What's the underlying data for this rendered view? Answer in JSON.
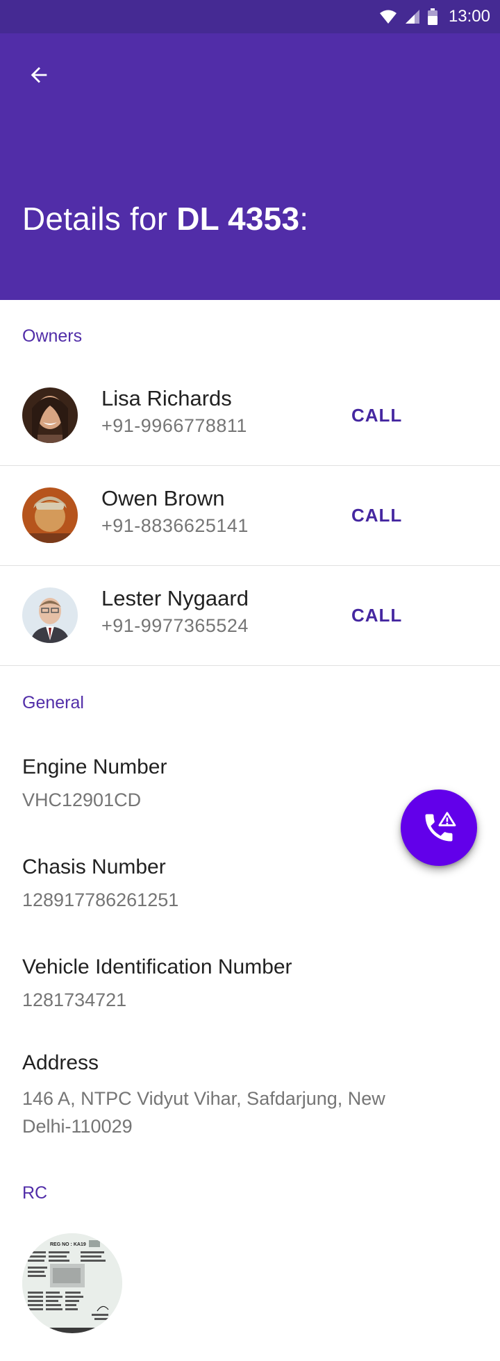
{
  "status_bar": {
    "time": "13:00"
  },
  "app_bar": {
    "title_prefix": "Details for ",
    "vehicle_id": "DL 4353",
    "title_suffix": ":"
  },
  "owners": {
    "header": "Owners",
    "items": [
      {
        "name": "Lisa Richards",
        "phone": "+91-9966778811",
        "action": "CALL"
      },
      {
        "name": "Owen Brown",
        "phone": "+91-8836625141",
        "action": "CALL"
      },
      {
        "name": "Lester Nygaard",
        "phone": "+91-9977365524",
        "action": "CALL"
      }
    ]
  },
  "general": {
    "header": "General",
    "fields": [
      {
        "label": "Engine Number",
        "value": "VHC12901CD"
      },
      {
        "label": "Chasis Number",
        "value": "128917786261251"
      },
      {
        "label": "Vehicle Identification Number",
        "value": "1281734721"
      },
      {
        "label": "Address",
        "value": "146 A, NTPC Vidyut Vihar, Safdarjung, New Delhi-110029"
      }
    ]
  },
  "rc": {
    "header": "RC",
    "document_text": "REG NO : KA19"
  },
  "fab": {
    "icon": "emergency-call-icon"
  },
  "colors": {
    "primary": "#512da8",
    "status_bar": "#452a93",
    "accent": "#6200ea",
    "link": "#4527a0"
  }
}
